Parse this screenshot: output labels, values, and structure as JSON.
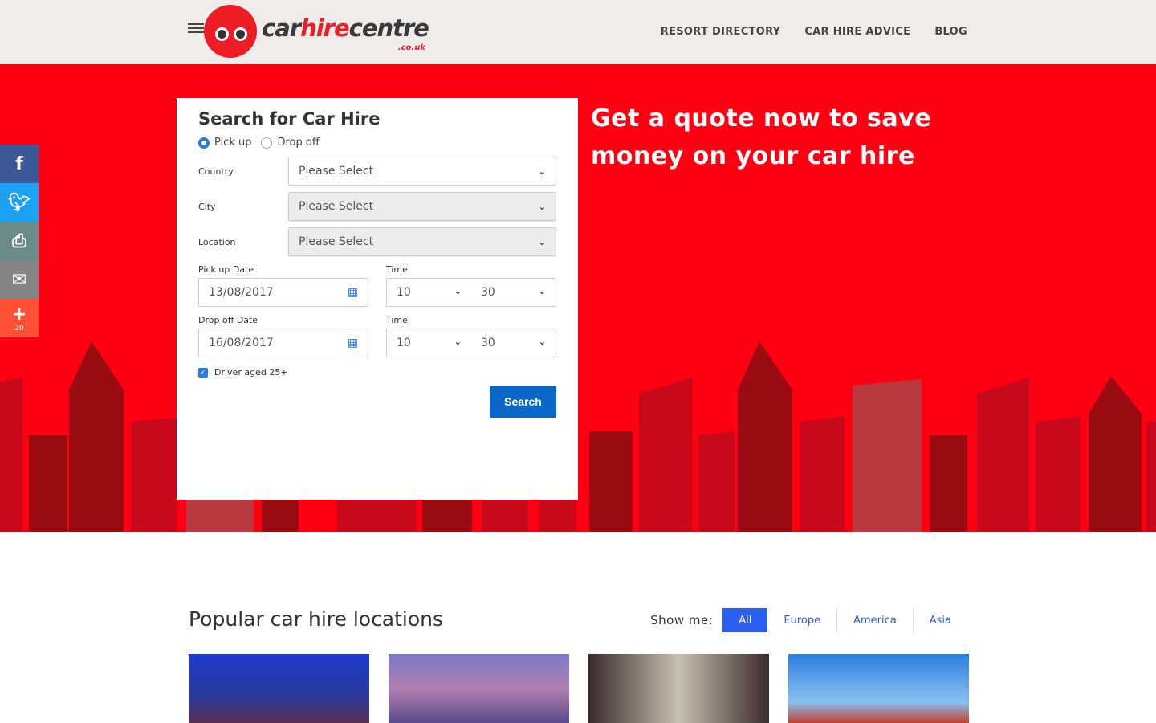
{
  "header": {
    "logo": {
      "car": "car",
      "hire": "hire",
      "centre": "centre",
      "tld": ".co.uk"
    },
    "nav": [
      "RESORT DIRECTORY",
      "CAR HIRE ADVICE",
      "BLOG"
    ]
  },
  "hero": {
    "tagline_line1": "Get a quote now to save",
    "tagline_line2": "money on your car hire"
  },
  "social": {
    "share_count": "20",
    "icons": [
      "facebook-icon",
      "twitter-icon",
      "print-icon",
      "email-icon",
      "plus-icon"
    ]
  },
  "form": {
    "title": "Search for Car Hire",
    "pickup_label": "Pick up",
    "dropoff_label": "Drop off",
    "country_label": "Country",
    "country_value": "Please Select",
    "city_label": "City",
    "city_value": "Please Select",
    "location_label": "Location",
    "location_value": "Please Select",
    "pickup_date_label": "Pick up Date",
    "pickup_date": "13/08/2017",
    "pickup_time_label": "Time",
    "pickup_hour": "10",
    "pickup_min": "30",
    "dropoff_date_label": "Drop off Date",
    "dropoff_date": "16/08/2017",
    "dropoff_time_label": "Time",
    "dropoff_hour": "10",
    "dropoff_min": "30",
    "driver_label": "Driver aged 25+",
    "search_label": "Search"
  },
  "popular": {
    "title": "Popular car hire locations",
    "show_me": "Show me:",
    "filters": [
      "All",
      "Europe",
      "America",
      "Asia"
    ]
  },
  "colors": {
    "brand_red": "#ff0013",
    "button_blue": "#0a67c8"
  }
}
